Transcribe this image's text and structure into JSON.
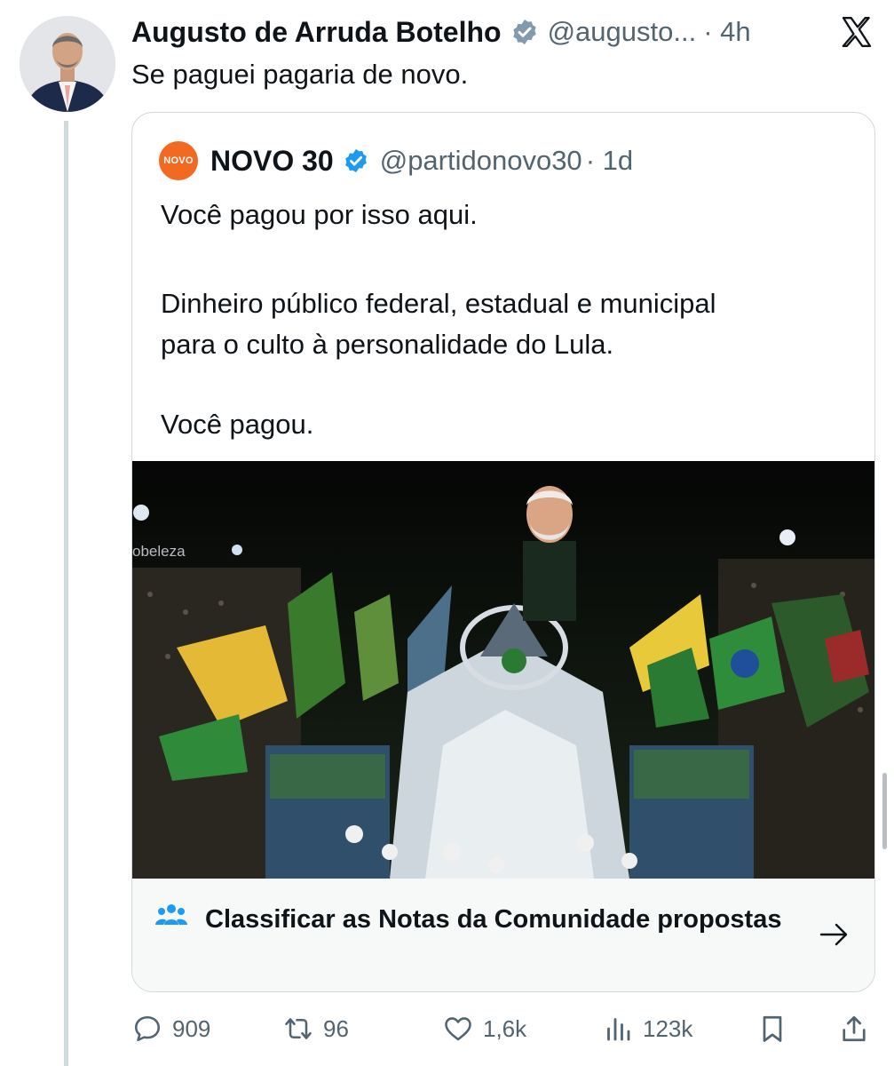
{
  "tweet": {
    "author_name": "Augusto de Arruda Botelho",
    "handle": "@augusto...",
    "time": "· 4h",
    "text": "Se paguei pagaria de novo."
  },
  "quoted_tweet": {
    "avatar_label": "NOVO",
    "author_name": "NOVO 30",
    "handle": "@partidonovo30",
    "time": "· 1d",
    "text_lines": [
      "Você pagou por isso aqui.",
      "Dinheiro público federal, estadual e municipal",
      "para o culto à personalidade do Lula.",
      "Você pagou."
    ],
    "media_watermark": "obeleza",
    "community_notes_label": "Classificar as Notas da Comunidade propostas"
  },
  "actions": {
    "replies": "909",
    "retweets": "96",
    "likes": "1,6k",
    "views": "123k"
  },
  "colors": {
    "text_primary": "#0f1419",
    "text_secondary": "#536471",
    "verified_blue": "#1d9bf0",
    "novo_orange": "#f26a21",
    "border": "#cfd9de"
  },
  "icons": {
    "verified": "verified-badge-icon",
    "platform": "x-logo-icon",
    "notes": "community-notes-people-icon",
    "arrow": "arrow-right-icon",
    "reply": "reply-bubble-icon",
    "retweet": "retweet-icon",
    "like": "heart-icon",
    "views": "views-bars-icon",
    "bookmark": "bookmark-icon",
    "share": "share-icon"
  }
}
